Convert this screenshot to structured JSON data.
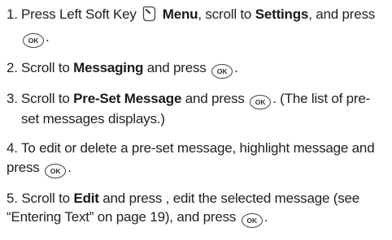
{
  "icons": {
    "ok_label": "OK",
    "softkey_icon": "left-soft-key-icon",
    "ok_icon": "ok-key-icon"
  },
  "steps": [
    {
      "num": "1.",
      "parts": [
        "Press Left Soft Key",
        "Menu",
        ", scroll to ",
        "Settings",
        ", and press",
        "."
      ]
    },
    {
      "num": "2.",
      "parts": [
        "Scroll to ",
        "Messaging",
        " and press",
        "."
      ]
    },
    {
      "num": "3.",
      "parts": [
        "Scroll to ",
        "Pre-Set Message",
        " and press",
        ". (The list of pre-set messages displays.)"
      ]
    },
    {
      "num": "4.",
      "parts": [
        "To edit or delete a pre-set message, highlight message and press",
        "."
      ]
    },
    {
      "num": "5.",
      "parts": [
        "Scroll to ",
        "Edit",
        " and press , edit the selected message (see “Entering Text” on page 19), and press",
        "."
      ]
    }
  ]
}
